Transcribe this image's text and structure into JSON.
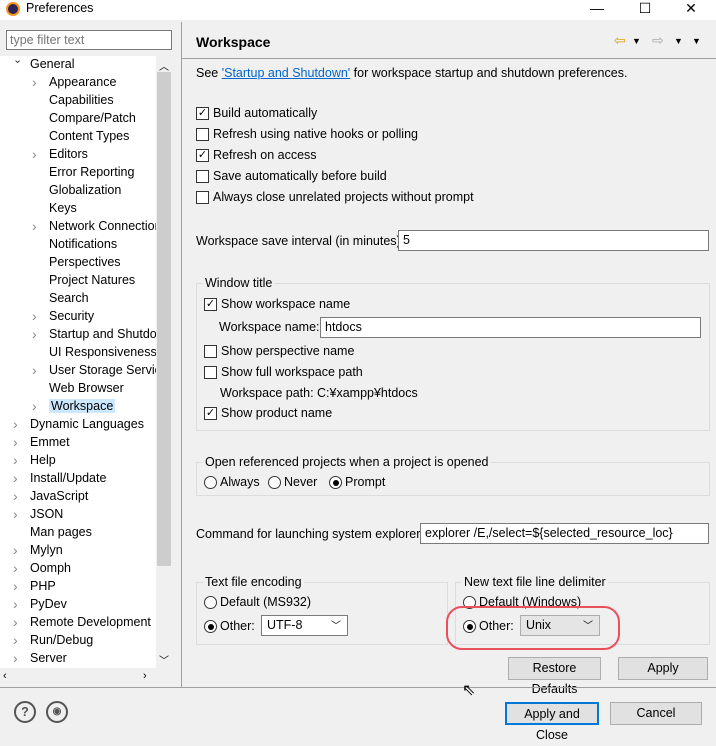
{
  "window": {
    "title": "Preferences",
    "minimize": "—",
    "maximize": "☐",
    "close": "✕"
  },
  "filter": {
    "placeholder": "type filter text"
  },
  "tree": [
    {
      "label": "General",
      "level": 0,
      "arrow": "down"
    },
    {
      "label": "Appearance",
      "level": 1,
      "arrow": "right"
    },
    {
      "label": "Capabilities",
      "level": 1
    },
    {
      "label": "Compare/Patch",
      "level": 1
    },
    {
      "label": "Content Types",
      "level": 1
    },
    {
      "label": "Editors",
      "level": 1,
      "arrow": "right"
    },
    {
      "label": "Error Reporting",
      "level": 1
    },
    {
      "label": "Globalization",
      "level": 1
    },
    {
      "label": "Keys",
      "level": 1
    },
    {
      "label": "Network Connection",
      "level": 1,
      "arrow": "right"
    },
    {
      "label": "Notifications",
      "level": 1
    },
    {
      "label": "Perspectives",
      "level": 1
    },
    {
      "label": "Project Natures",
      "level": 1
    },
    {
      "label": "Search",
      "level": 1
    },
    {
      "label": "Security",
      "level": 1,
      "arrow": "right"
    },
    {
      "label": "Startup and Shutdow",
      "level": 1,
      "arrow": "right"
    },
    {
      "label": "UI Responsiveness M",
      "level": 1
    },
    {
      "label": "User Storage Service",
      "level": 1,
      "arrow": "right"
    },
    {
      "label": "Web Browser",
      "level": 1
    },
    {
      "label": "Workspace",
      "level": 1,
      "arrow": "right",
      "selected": true
    },
    {
      "label": "Dynamic Languages",
      "level": 0,
      "arrow": "right"
    },
    {
      "label": "Emmet",
      "level": 0,
      "arrow": "right"
    },
    {
      "label": "Help",
      "level": 0,
      "arrow": "right"
    },
    {
      "label": "Install/Update",
      "level": 0,
      "arrow": "right"
    },
    {
      "label": "JavaScript",
      "level": 0,
      "arrow": "right"
    },
    {
      "label": "JSON",
      "level": 0,
      "arrow": "right"
    },
    {
      "label": "Man pages",
      "level": 0
    },
    {
      "label": "Mylyn",
      "level": 0,
      "arrow": "right"
    },
    {
      "label": "Oomph",
      "level": 0,
      "arrow": "right"
    },
    {
      "label": "PHP",
      "level": 0,
      "arrow": "right"
    },
    {
      "label": "PyDev",
      "level": 0,
      "arrow": "right"
    },
    {
      "label": "Remote Development",
      "level": 0,
      "arrow": "right"
    },
    {
      "label": "Run/Debug",
      "level": 0,
      "arrow": "right"
    },
    {
      "label": "Server",
      "level": 0,
      "arrow": "right"
    }
  ],
  "page": {
    "title": "Workspace",
    "intro_pre": "See ",
    "intro_link": "'Startup and Shutdown'",
    "intro_post": " for workspace startup and shutdown preferences.",
    "checks": [
      {
        "label": "Build automatically",
        "checked": true
      },
      {
        "label": "Refresh using native hooks or polling",
        "checked": false
      },
      {
        "label": "Refresh on access",
        "checked": true
      },
      {
        "label": "Save automatically before build",
        "checked": false
      },
      {
        "label": "Always close unrelated projects without prompt",
        "checked": false
      }
    ],
    "save_interval_label": "Workspace save interval (in minutes):",
    "save_interval": "5",
    "window_title": {
      "group": "Window title",
      "show_ws_name": "Show workspace name",
      "ws_name_label": "Workspace name:",
      "ws_name": "htdocs",
      "show_persp": "Show perspective name",
      "show_full_path": "Show full workspace path",
      "ws_path_label": "Workspace path:",
      "ws_path": "C:¥xampp¥htdocs",
      "show_product": "Show product name"
    },
    "open_ref": {
      "group": "Open referenced projects when a project is opened",
      "options": [
        "Always",
        "Never",
        "Prompt"
      ],
      "selected": "Prompt"
    },
    "explorer_label": "Command for launching system explorer:",
    "explorer_cmd": "explorer /E,/select=${selected_resource_loc}",
    "encoding": {
      "group": "Text file encoding",
      "default": "Default (MS932)",
      "other": "Other:",
      "value": "UTF-8"
    },
    "delimiter": {
      "group": "New text file line delimiter",
      "default": "Default (Windows)",
      "other": "Other:",
      "value": "Unix"
    },
    "restore": "Restore Defaults",
    "apply": "Apply"
  },
  "footer": {
    "help": "?",
    "apply_close": "Apply and Close",
    "cancel": "Cancel"
  },
  "colors": {
    "accent": "#0078d7",
    "highlight": "#e8505a",
    "selection": "#cce8ff"
  }
}
